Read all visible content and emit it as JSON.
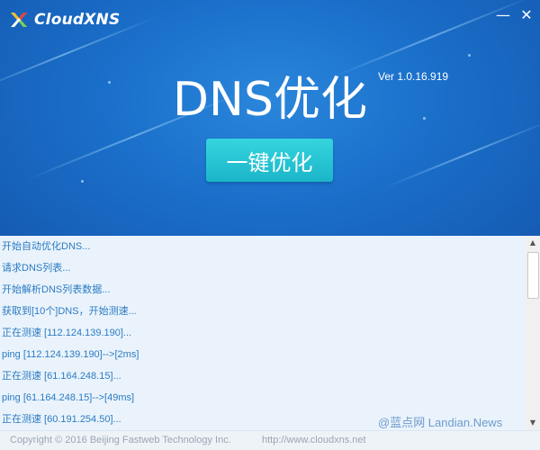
{
  "app": {
    "name": "CloudXNS",
    "title": "DNS优化",
    "version": "Ver 1.0.16.919",
    "optimize_button": "一键优化",
    "window_controls": {
      "minimize": "—",
      "close": "✕"
    }
  },
  "log": {
    "lines": [
      "开始自动优化DNS...",
      "请求DNS列表...",
      "开始解析DNS列表数据...",
      "获取到[10个]DNS，开始测速...",
      "正在测速 [112.124.139.190]...",
      "ping [112.124.139.190]-->[2ms]",
      "正在测速 [61.164.248.15]...",
      "ping [61.164.248.15]-->[49ms]",
      "正在测速 [60.191.254.50]..."
    ]
  },
  "watermark": "@蓝点网 Landian.News",
  "footer": {
    "copyright": "Copyright © 2016 Beijing Fastweb Technology Inc.",
    "website": "http://www.cloudxns.net"
  },
  "colors": {
    "header_blue": "#1a6fc9",
    "button_cyan": "#22c3d3",
    "log_text": "#2b7bc4",
    "log_bg": "#eaf3fb"
  }
}
